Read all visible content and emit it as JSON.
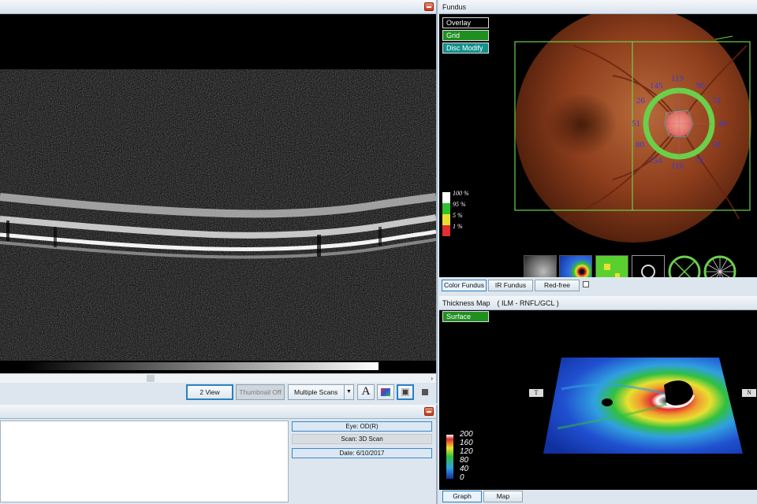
{
  "scan_panel": {
    "toolbar": {
      "two_view": "2 View",
      "thumbnail_off": "Thumbnail Off",
      "scan_mode": "Multiple Scans"
    },
    "font_icon_label": "A"
  },
  "info_panel": {
    "eye": "Eye: OD(R)",
    "scan": "Scan: 3D Scan",
    "date": "Date: 6/10/2017"
  },
  "fundus_panel": {
    "title": "Fundus",
    "overlay_buttons": [
      "Overlay",
      "Grid",
      "Disc Modify"
    ],
    "legend": [
      "100 %",
      "95 %",
      "5 %",
      "1 %"
    ],
    "legend_colors": [
      "#ffffff",
      "#30c030",
      "#e8e030",
      "#e03030"
    ],
    "sector_values": {
      "s1": "145",
      "s2": "119",
      "s3": "90",
      "t1": "26",
      "t2": "51",
      "t3": "80",
      "n1": "74",
      "n2": "46",
      "n3": "58",
      "i1": "154",
      "i2": "116",
      "i3": "78"
    },
    "tabs": [
      "Color Fundus",
      "IR Fundus",
      "Red-free"
    ]
  },
  "thickness_panel": {
    "title": "Thickness Map　( ILM - RNFL/GCL )",
    "surface_button": "Surface",
    "colorbar_ticks": [
      "200",
      "160",
      "120",
      "80",
      "40",
      "0"
    ],
    "orientation_left": "T",
    "orientation_right": "N",
    "tabs": [
      "Graph",
      "Map"
    ]
  }
}
